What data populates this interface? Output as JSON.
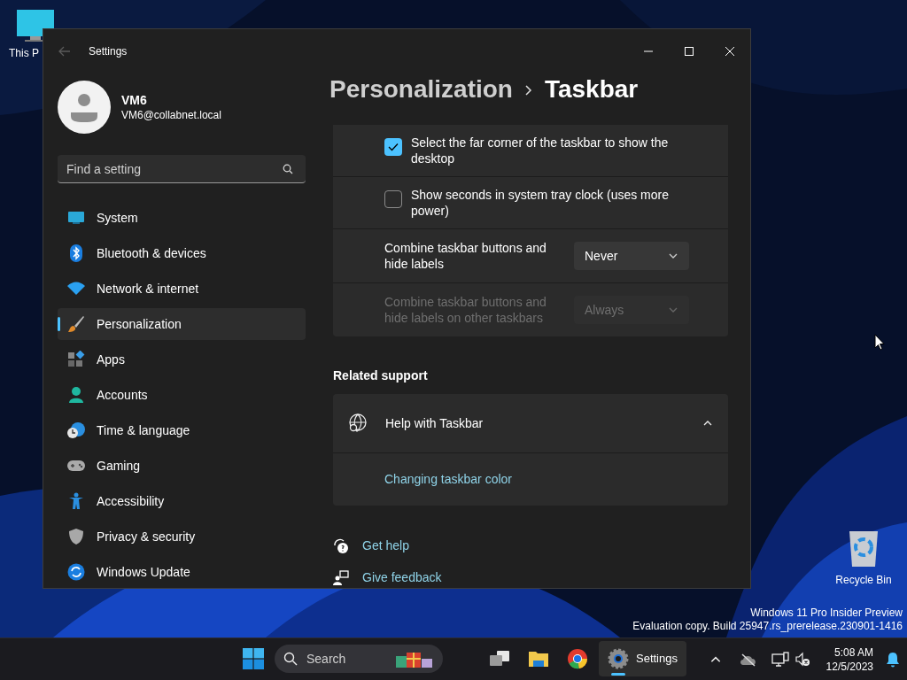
{
  "desktop": {
    "icons": [
      {
        "label": "This P"
      },
      {
        "label": "Recycle Bin"
      }
    ],
    "watermark": [
      "Windows 11 Pro Insider Preview",
      "Evaluation copy. Build 25947.rs_prerelease.230901-1416"
    ]
  },
  "window": {
    "title": "Settings",
    "user": {
      "name": "VM6",
      "email": "VM6@collabnet.local"
    },
    "search": {
      "placeholder": "Find a setting"
    },
    "nav": [
      {
        "label": "System",
        "selected": false
      },
      {
        "label": "Bluetooth & devices",
        "selected": false
      },
      {
        "label": "Network & internet",
        "selected": false
      },
      {
        "label": "Personalization",
        "selected": true
      },
      {
        "label": "Apps",
        "selected": false
      },
      {
        "label": "Accounts",
        "selected": false
      },
      {
        "label": "Time & language",
        "selected": false
      },
      {
        "label": "Gaming",
        "selected": false
      },
      {
        "label": "Accessibility",
        "selected": false
      },
      {
        "label": "Privacy & security",
        "selected": false
      },
      {
        "label": "Windows Update",
        "selected": false
      }
    ],
    "breadcrumb": [
      "Personalization",
      "Taskbar"
    ],
    "settings": [
      {
        "kind": "checkbox",
        "label": "Select the far corner of the taskbar to show the desktop",
        "checked": true
      },
      {
        "kind": "checkbox",
        "label": "Show seconds in system tray clock (uses more power)",
        "checked": false
      },
      {
        "kind": "dropdown",
        "label": "Combine taskbar buttons and hide labels",
        "value": "Never",
        "disabled": false
      },
      {
        "kind": "dropdown",
        "label": "Combine taskbar buttons and hide labels on other taskbars",
        "value": "Always",
        "disabled": true
      }
    ],
    "related_support": {
      "heading": "Related support",
      "expander": {
        "title": "Help with Taskbar",
        "expanded": true,
        "links": [
          "Changing taskbar color"
        ]
      }
    },
    "footer_links": [
      {
        "kind": "help",
        "label": "Get help"
      },
      {
        "kind": "feedback",
        "label": "Give feedback"
      }
    ]
  },
  "taskbar": {
    "search_placeholder": "Search",
    "apps": [
      {
        "kind": "taskview",
        "active": false
      },
      {
        "kind": "explorer",
        "active": false
      },
      {
        "kind": "browser",
        "active": false
      },
      {
        "kind": "settings",
        "label": "Settings",
        "active": true
      }
    ],
    "time": "5:08 AM",
    "date": "12/5/2023"
  }
}
